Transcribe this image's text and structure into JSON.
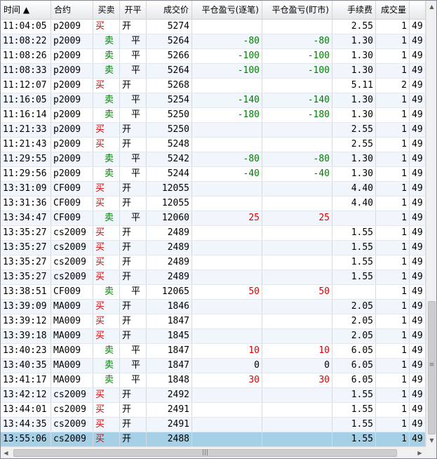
{
  "columns": [
    {
      "label": "时间 ▲",
      "align": "l"
    },
    {
      "label": "合约",
      "align": "l"
    },
    {
      "label": "买卖",
      "align": "c"
    },
    {
      "label": "开平",
      "align": "c"
    },
    {
      "label": "成交价",
      "align": "r"
    },
    {
      "label": "平仓盈亏(逐笔)",
      "align": "r"
    },
    {
      "label": "平仓盈亏(盯市)",
      "align": "r"
    },
    {
      "label": "手续费",
      "align": "r"
    },
    {
      "label": "成交量",
      "align": "r"
    },
    {
      "label": "",
      "align": "l"
    }
  ],
  "rows": [
    {
      "time": "11:04:05",
      "contract": "p2009",
      "side": "买",
      "oc": "开",
      "price": "5274",
      "pnl_each": "",
      "pnl_mkt": "",
      "fee": "2.55",
      "qty": "1",
      "extra": "49"
    },
    {
      "time": "11:08:22",
      "contract": "p2009",
      "side": "卖",
      "oc": "平",
      "price": "5264",
      "pnl_each": "-80",
      "pnl_mkt": "-80",
      "fee": "1.30",
      "qty": "1",
      "extra": "49"
    },
    {
      "time": "11:08:26",
      "contract": "p2009",
      "side": "卖",
      "oc": "平",
      "price": "5266",
      "pnl_each": "-100",
      "pnl_mkt": "-100",
      "fee": "1.30",
      "qty": "1",
      "extra": "49"
    },
    {
      "time": "11:08:33",
      "contract": "p2009",
      "side": "卖",
      "oc": "平",
      "price": "5264",
      "pnl_each": "-100",
      "pnl_mkt": "-100",
      "fee": "1.30",
      "qty": "1",
      "extra": "49"
    },
    {
      "time": "11:12:07",
      "contract": "p2009",
      "side": "买",
      "oc": "开",
      "price": "5268",
      "pnl_each": "",
      "pnl_mkt": "",
      "fee": "5.11",
      "qty": "2",
      "extra": "49"
    },
    {
      "time": "11:16:05",
      "contract": "p2009",
      "side": "卖",
      "oc": "平",
      "price": "5254",
      "pnl_each": "-140",
      "pnl_mkt": "-140",
      "fee": "1.30",
      "qty": "1",
      "extra": "49"
    },
    {
      "time": "11:16:14",
      "contract": "p2009",
      "side": "卖",
      "oc": "平",
      "price": "5250",
      "pnl_each": "-180",
      "pnl_mkt": "-180",
      "fee": "1.30",
      "qty": "1",
      "extra": "49"
    },
    {
      "time": "11:21:33",
      "contract": "p2009",
      "side": "买",
      "oc": "开",
      "price": "5250",
      "pnl_each": "",
      "pnl_mkt": "",
      "fee": "2.55",
      "qty": "1",
      "extra": "49"
    },
    {
      "time": "11:21:43",
      "contract": "p2009",
      "side": "买",
      "oc": "开",
      "price": "5248",
      "pnl_each": "",
      "pnl_mkt": "",
      "fee": "2.55",
      "qty": "1",
      "extra": "49"
    },
    {
      "time": "11:29:55",
      "contract": "p2009",
      "side": "卖",
      "oc": "平",
      "price": "5242",
      "pnl_each": "-80",
      "pnl_mkt": "-80",
      "fee": "1.30",
      "qty": "1",
      "extra": "49"
    },
    {
      "time": "11:29:56",
      "contract": "p2009",
      "side": "卖",
      "oc": "平",
      "price": "5244",
      "pnl_each": "-40",
      "pnl_mkt": "-40",
      "fee": "1.30",
      "qty": "1",
      "extra": "49"
    },
    {
      "time": "13:31:09",
      "contract": "CF009",
      "side": "买",
      "oc": "开",
      "price": "12055",
      "pnl_each": "",
      "pnl_mkt": "",
      "fee": "4.40",
      "qty": "1",
      "extra": "49"
    },
    {
      "time": "13:31:36",
      "contract": "CF009",
      "side": "买",
      "oc": "开",
      "price": "12055",
      "pnl_each": "",
      "pnl_mkt": "",
      "fee": "4.40",
      "qty": "1",
      "extra": "49"
    },
    {
      "time": "13:34:47",
      "contract": "CF009",
      "side": "卖",
      "oc": "平",
      "price": "12060",
      "pnl_each": "25",
      "pnl_mkt": "25",
      "fee": "",
      "qty": "1",
      "extra": "49"
    },
    {
      "time": "13:35:27",
      "contract": "cs2009",
      "side": "买",
      "oc": "开",
      "price": "2489",
      "pnl_each": "",
      "pnl_mkt": "",
      "fee": "1.55",
      "qty": "1",
      "extra": "49"
    },
    {
      "time": "13:35:27",
      "contract": "cs2009",
      "side": "买",
      "oc": "开",
      "price": "2489",
      "pnl_each": "",
      "pnl_mkt": "",
      "fee": "1.55",
      "qty": "1",
      "extra": "49"
    },
    {
      "time": "13:35:27",
      "contract": "cs2009",
      "side": "买",
      "oc": "开",
      "price": "2489",
      "pnl_each": "",
      "pnl_mkt": "",
      "fee": "1.55",
      "qty": "1",
      "extra": "49"
    },
    {
      "time": "13:35:27",
      "contract": "cs2009",
      "side": "买",
      "oc": "开",
      "price": "2489",
      "pnl_each": "",
      "pnl_mkt": "",
      "fee": "1.55",
      "qty": "1",
      "extra": "49"
    },
    {
      "time": "13:38:51",
      "contract": "CF009",
      "side": "卖",
      "oc": "平",
      "price": "12065",
      "pnl_each": "50",
      "pnl_mkt": "50",
      "fee": "",
      "qty": "1",
      "extra": "49"
    },
    {
      "time": "13:39:09",
      "contract": "MA009",
      "side": "买",
      "oc": "开",
      "price": "1846",
      "pnl_each": "",
      "pnl_mkt": "",
      "fee": "2.05",
      "qty": "1",
      "extra": "49"
    },
    {
      "time": "13:39:12",
      "contract": "MA009",
      "side": "买",
      "oc": "开",
      "price": "1847",
      "pnl_each": "",
      "pnl_mkt": "",
      "fee": "2.05",
      "qty": "1",
      "extra": "49"
    },
    {
      "time": "13:39:18",
      "contract": "MA009",
      "side": "买",
      "oc": "开",
      "price": "1845",
      "pnl_each": "",
      "pnl_mkt": "",
      "fee": "2.05",
      "qty": "1",
      "extra": "49"
    },
    {
      "time": "13:40:23",
      "contract": "MA009",
      "side": "卖",
      "oc": "平",
      "price": "1847",
      "pnl_each": "10",
      "pnl_mkt": "10",
      "fee": "6.05",
      "qty": "1",
      "extra": "49"
    },
    {
      "time": "13:40:35",
      "contract": "MA009",
      "side": "卖",
      "oc": "平",
      "price": "1847",
      "pnl_each": "0",
      "pnl_mkt": "0",
      "fee": "6.05",
      "qty": "1",
      "extra": "49"
    },
    {
      "time": "13:41:17",
      "contract": "MA009",
      "side": "卖",
      "oc": "平",
      "price": "1848",
      "pnl_each": "30",
      "pnl_mkt": "30",
      "fee": "6.05",
      "qty": "1",
      "extra": "49"
    },
    {
      "time": "13:42:12",
      "contract": "cs2009",
      "side": "买",
      "oc": "开",
      "price": "2492",
      "pnl_each": "",
      "pnl_mkt": "",
      "fee": "1.55",
      "qty": "1",
      "extra": "49"
    },
    {
      "time": "13:44:01",
      "contract": "cs2009",
      "side": "买",
      "oc": "开",
      "price": "2491",
      "pnl_each": "",
      "pnl_mkt": "",
      "fee": "1.55",
      "qty": "1",
      "extra": "49"
    },
    {
      "time": "13:44:35",
      "contract": "cs2009",
      "side": "买",
      "oc": "开",
      "price": "2491",
      "pnl_each": "",
      "pnl_mkt": "",
      "fee": "1.55",
      "qty": "1",
      "extra": "49"
    },
    {
      "time": "13:55:06",
      "contract": "cs2009",
      "side": "买",
      "oc": "开",
      "price": "2488",
      "pnl_each": "",
      "pnl_mkt": "",
      "fee": "1.55",
      "qty": "1",
      "extra": "49"
    }
  ],
  "selected_row": 28,
  "buy_label": "买",
  "colors": {
    "profit": "#e00000",
    "loss": "#008000",
    "selection": "#a6d0e6",
    "stripe": "#f0f6fc"
  },
  "scroll": {
    "up_glyph": "▲",
    "down_glyph": "▼",
    "left_glyph": "◀",
    "right_glyph": "▶",
    "grip_glyph": "≡",
    "hgrip_glyph": "|||"
  }
}
